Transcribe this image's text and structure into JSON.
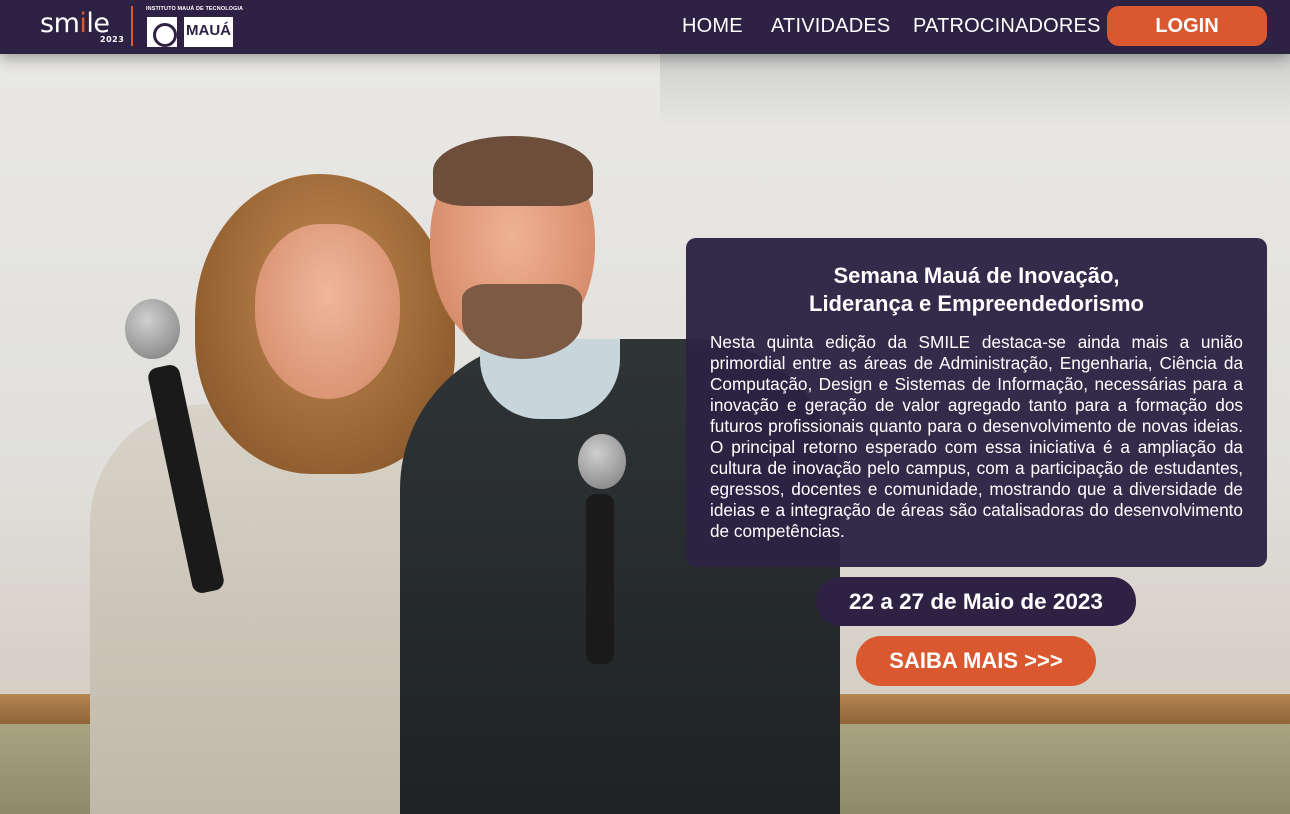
{
  "header": {
    "logo_text_before": "sm",
    "logo_text_accent": "i",
    "logo_text_after": "le",
    "logo_year": "2023",
    "institute_label": "INSTITUTO MAUÁ DE TECNOLOGIA",
    "institute_name": "MAUÁ",
    "nav": {
      "home": "HOME",
      "atividades": "ATIVIDADES",
      "patrocinadores": "PATROCINADORES"
    },
    "login_label": "LOGIN"
  },
  "hero": {
    "title_line1": "Semana Mauá de Inovação,",
    "title_line2": "Liderança e Empreendedorismo",
    "description": "Nesta quinta edição da SMILE destaca-se ainda mais a união primordial entre as áreas de Administração, Engenharia, Ciência da Computação, Design e Sistemas de Informação, necessárias para a inovação e geração de valor agregado tanto para a formação dos futuros profissionais quanto para o desenvolvimento de novas ideias. O principal retorno esperado com essa iniciativa é a ampliação da cultura de inovação pelo campus, com a participação de estudantes, egressos, docentes e comunidade, mostrando que a diversidade de ideias e a integração de áreas são catalisadoras do desenvolvimento de competências.",
    "date": "22 a 27 de Maio de 2023",
    "cta_label": "SAIBA MAIS >>>"
  },
  "colors": {
    "navy": "#2d2244",
    "accent_orange": "#d9582f"
  }
}
